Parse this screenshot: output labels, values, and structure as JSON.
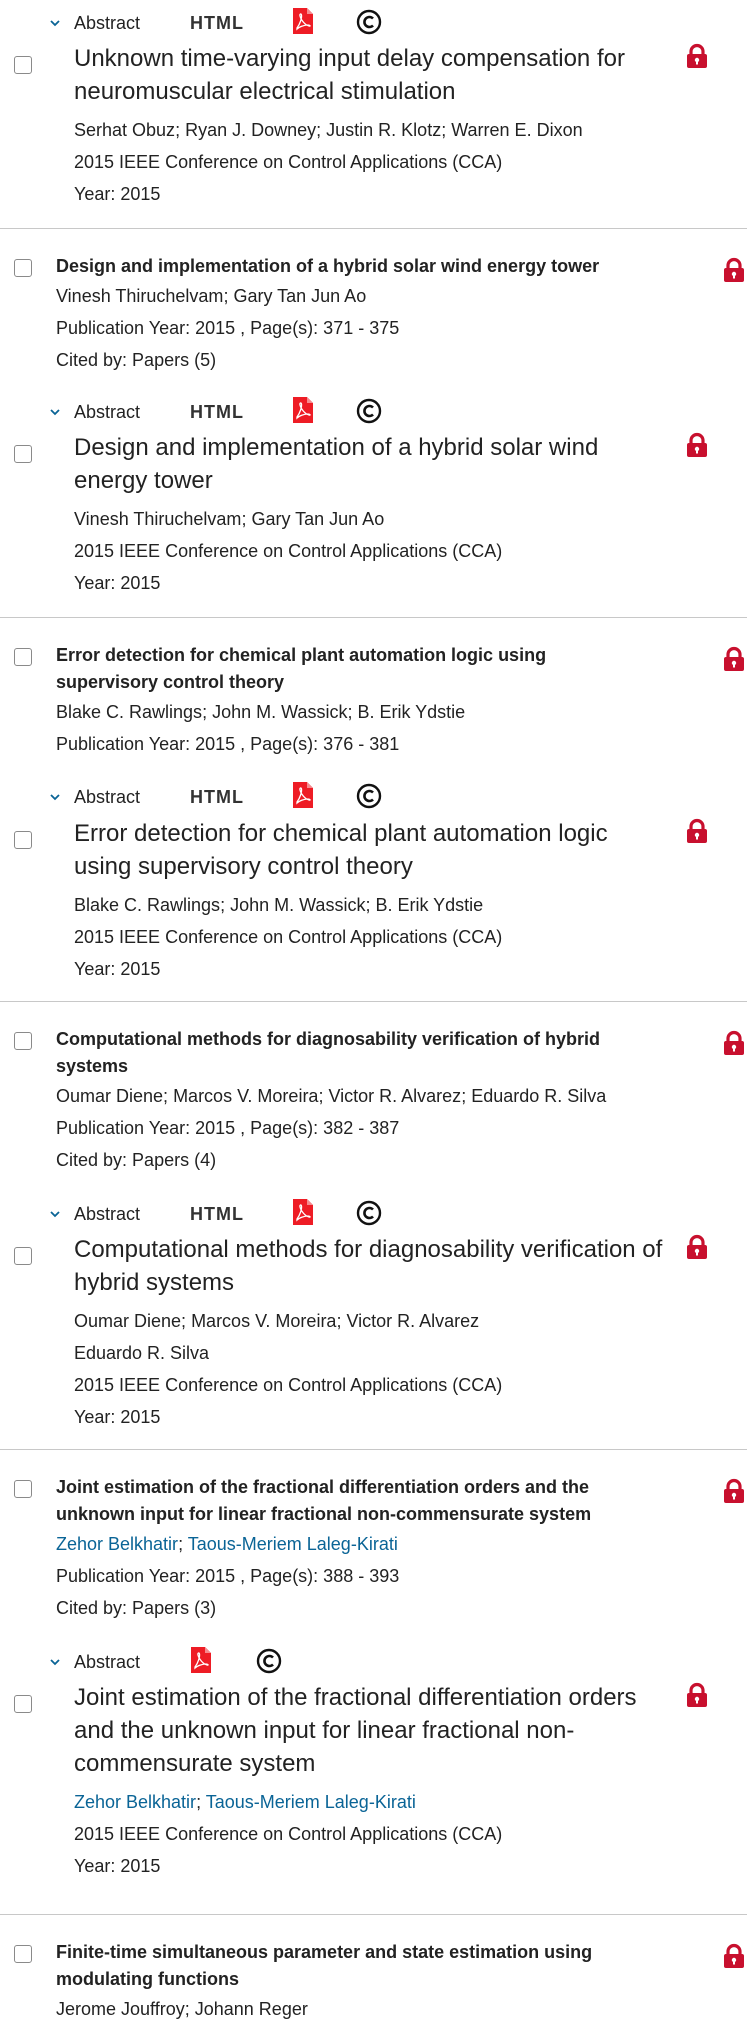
{
  "labels": {
    "abstract": "Abstract",
    "html": "HTML",
    "cited_prefix": "Cited by: "
  },
  "colors": {
    "lock": "#c8102e",
    "pdf": "#ee1c25",
    "link": "#0a6496",
    "divider": "#c8c8c8"
  },
  "icons": {
    "lock": "lock-icon",
    "pdf": "pdf-icon",
    "copyright": "copyright-icon",
    "chevron": "chevron-down-icon"
  },
  "items": [
    {
      "kind": "partial",
      "abstract_row": {
        "has_html": true
      },
      "card": {
        "title_lines": [
          "Unknown time-varying input delay compensation for",
          "neuromuscular electrical stimulation"
        ],
        "authors": [
          {
            "name": "Serhat Obuz",
            "link": false
          },
          {
            "name": "Ryan J. Downey",
            "link": false
          },
          {
            "name": "Justin R. Klotz",
            "link": false
          },
          {
            "name": "Warren E. Dixon",
            "link": false
          }
        ],
        "conference": "2015 IEEE Conference on Control Applications (CCA)",
        "year": "Year: 2015"
      }
    },
    {
      "title_lines": [
        "Design and implementation of a hybrid solar wind energy tower"
      ],
      "authors": [
        {
          "name": "Vinesh Thiruchelvam",
          "link": false
        },
        {
          "name": "Gary Tan Jun Ao",
          "link": false
        }
      ],
      "pub": "Publication Year: 2015 , Page(s): 371  -  375",
      "cited": "Papers (5)",
      "abstract_row": {
        "has_html": true
      },
      "card": {
        "title_lines": [
          "Design and implementation of a hybrid solar wind",
          "energy tower"
        ],
        "authors": [
          {
            "name": "Vinesh Thiruchelvam",
            "link": false
          },
          {
            "name": "Gary Tan Jun Ao",
            "link": false
          }
        ],
        "conference": "2015 IEEE Conference on Control Applications (CCA)",
        "year": "Year: 2015"
      }
    },
    {
      "title_lines": [
        "Error detection for chemical plant automation logic using",
        "supervisory control theory"
      ],
      "authors": [
        {
          "name": "Blake C. Rawlings",
          "link": false
        },
        {
          "name": "John M. Wassick",
          "link": false
        },
        {
          "name": "B. Erik Ydstie",
          "link": false
        }
      ],
      "pub": "Publication Year: 2015 , Page(s): 376  -  381",
      "cited": null,
      "abstract_row": {
        "has_html": true
      },
      "card": {
        "title_lines": [
          "Error detection for chemical plant automation logic",
          "using supervisory control theory"
        ],
        "authors": [
          {
            "name": "Blake C. Rawlings",
            "link": false
          },
          {
            "name": "John M. Wassick",
            "link": false
          },
          {
            "name": "B. Erik Ydstie",
            "link": false
          }
        ],
        "conference": "2015 IEEE Conference on Control Applications (CCA)",
        "year": "Year: 2015"
      }
    },
    {
      "title_lines": [
        "Computational methods for diagnosability verification of hybrid",
        "systems"
      ],
      "authors": [
        {
          "name": "Oumar Diene",
          "link": false
        },
        {
          "name": "Marcos V. Moreira",
          "link": false
        },
        {
          "name": "Victor R. Alvarez",
          "link": false
        },
        {
          "name": "Eduardo R. Silva",
          "link": false
        }
      ],
      "pub": "Publication Year: 2015 , Page(s): 382  -  387",
      "cited": "Papers (4)",
      "abstract_row": {
        "has_html": true
      },
      "card": {
        "title_lines": [
          "Computational methods for diagnosability verification of",
          "hybrid systems"
        ],
        "author_lines": [
          [
            {
              "name": "Oumar Diene",
              "link": false
            },
            {
              "name": "Marcos V. Moreira",
              "link": false
            },
            {
              "name": "Victor R. Alvarez",
              "link": false
            }
          ],
          [
            {
              "name": "Eduardo R. Silva",
              "link": false
            }
          ]
        ],
        "conference": "2015 IEEE Conference on Control Applications (CCA)",
        "year": "Year: 2015"
      }
    },
    {
      "title_lines": [
        "Joint estimation of the fractional differentiation orders and the",
        "unknown input for linear fractional non-commensurate system"
      ],
      "authors": [
        {
          "name": "Zehor Belkhatir",
          "link": true
        },
        {
          "name": "Taous-Meriem Laleg-Kirati",
          "link": true
        }
      ],
      "pub": "Publication Year: 2015 , Page(s): 388  -  393",
      "cited": "Papers (3)",
      "abstract_row": {
        "has_html": false
      },
      "card": {
        "title_lines": [
          "Joint estimation of the fractional differentiation orders",
          "and the unknown input for linear fractional non-",
          "commensurate system"
        ],
        "authors": [
          {
            "name": "Zehor Belkhatir",
            "link": true
          },
          {
            "name": "Taous-Meriem Laleg-Kirati",
            "link": true
          }
        ],
        "conference": "2015 IEEE Conference on Control Applications (CCA)",
        "year": "Year: 2015"
      }
    },
    {
      "title_lines": [
        "Finite-time simultaneous parameter and state estimation using",
        "modulating functions"
      ],
      "authors": [
        {
          "name": "Jerome Jouffroy",
          "link": false
        },
        {
          "name": "Johann Reger",
          "link": false
        }
      ]
    }
  ]
}
